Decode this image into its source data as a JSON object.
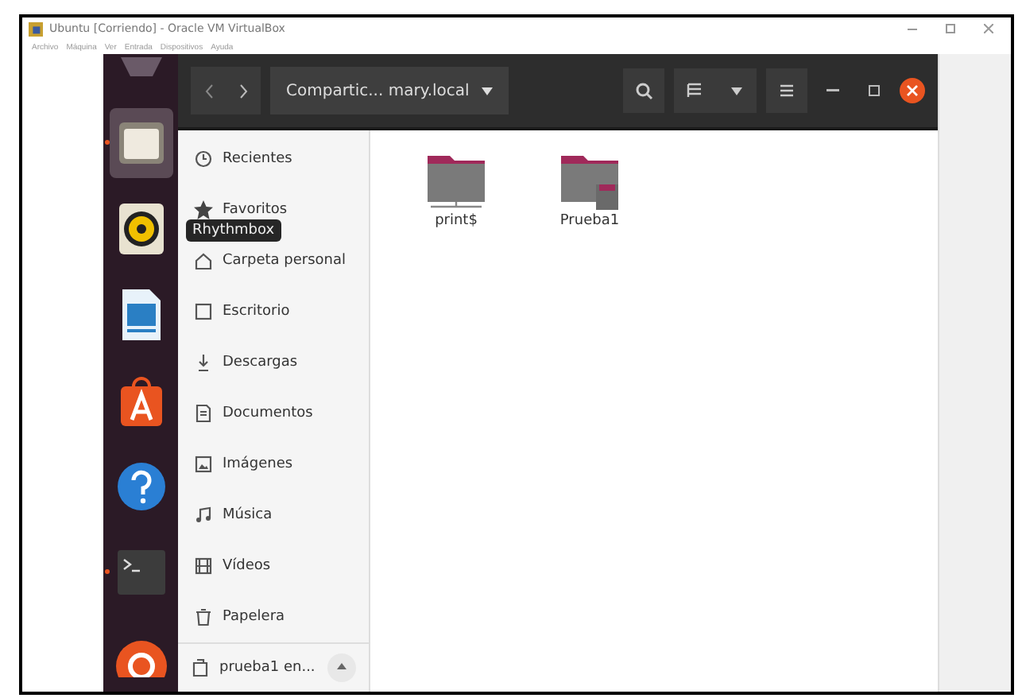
{
  "window": {
    "title": "Ubuntu [Corriendo] - Oracle VM VirtualBox",
    "menu": [
      "Archivo",
      "Máquina",
      "Ver",
      "Entrada",
      "Dispositivos",
      "Ayuda"
    ]
  },
  "dock": [
    {
      "kind": "partial",
      "active": false,
      "running": false
    },
    {
      "kind": "files",
      "active": true,
      "running": true
    },
    {
      "kind": "rhythmbox",
      "active": false,
      "running": false
    },
    {
      "kind": "writer",
      "active": false,
      "running": false
    },
    {
      "kind": "software",
      "active": false,
      "running": false
    },
    {
      "kind": "help",
      "active": false,
      "running": false
    },
    {
      "kind": "terminal",
      "active": false,
      "running": true
    },
    {
      "kind": "ubuntu",
      "active": false,
      "running": false
    }
  ],
  "tooltip": "Rhythmbox",
  "headerbar": {
    "path": "Compartic... mary.local"
  },
  "sidebar": {
    "items": [
      {
        "label": "Recientes",
        "selected": false
      },
      {
        "label": "Favoritos",
        "selected": false
      },
      {
        "label": "Carpeta personal",
        "selected": false
      },
      {
        "label": "Escritorio",
        "selected": false
      },
      {
        "label": "Descargas",
        "selected": false
      },
      {
        "label": "Documentos",
        "selected": false
      },
      {
        "label": "Imágenes",
        "selected": false
      },
      {
        "label": "Música",
        "selected": false
      },
      {
        "label": "Vídeos",
        "selected": false
      },
      {
        "label": "Papelera",
        "selected": false
      }
    ],
    "mount": {
      "label": "prueba1 en..."
    }
  },
  "files": [
    {
      "name": "print$",
      "kind": "share"
    },
    {
      "name": "Prueba1",
      "kind": "folder-shared"
    }
  ]
}
